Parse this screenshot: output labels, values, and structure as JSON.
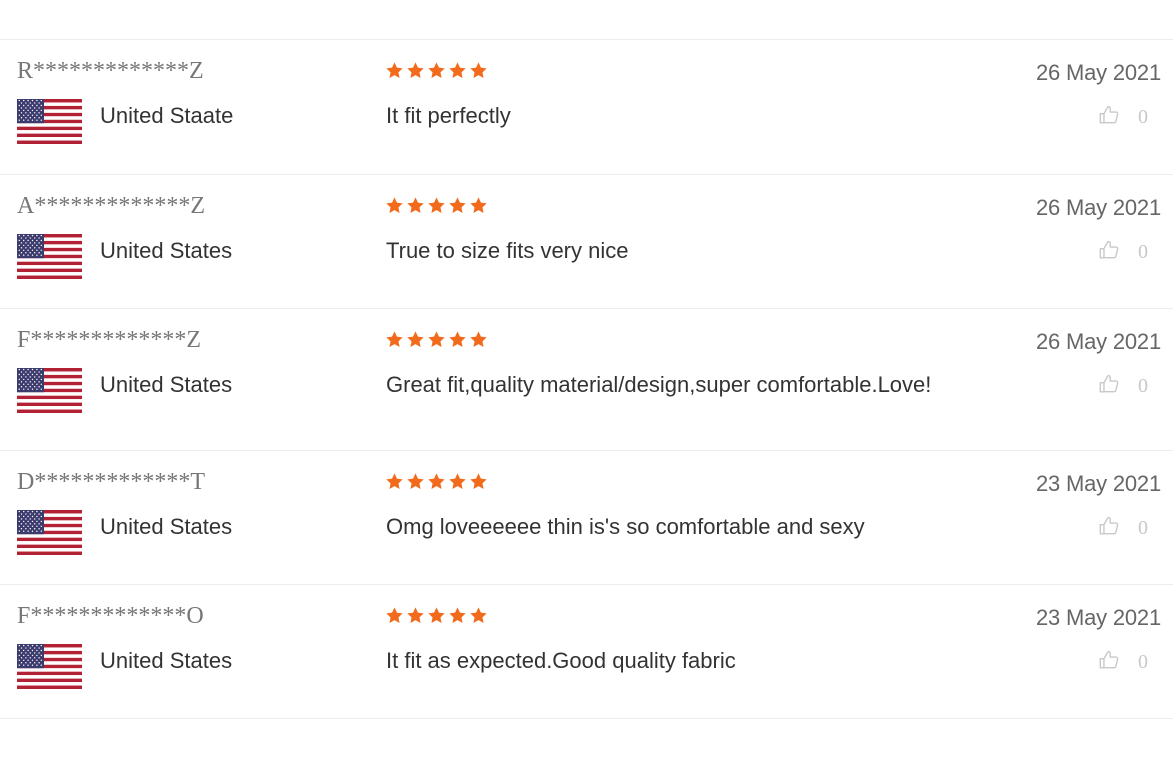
{
  "colors": {
    "star": "#f26b1d",
    "divider": "#ececec",
    "muted": "#c8c8c8"
  },
  "reviews": [
    {
      "name": "R*************Z",
      "country": "United Staate",
      "flag_icon": "us-flag-icon",
      "rating": 5,
      "content": "It fit perfectly",
      "date": "26 May 2021",
      "likes": "0"
    },
    {
      "name": "A*************Z",
      "country": "United States",
      "flag_icon": "us-flag-icon",
      "rating": 5,
      "content": "True to size fits very nice",
      "date": "26 May 2021",
      "likes": "0"
    },
    {
      "name": "F*************Z",
      "country": "United States",
      "flag_icon": "us-flag-icon",
      "rating": 5,
      "content": "Great fit,quality material/design,super comfortable.Love!",
      "date": "26 May 2021",
      "likes": "0"
    },
    {
      "name": "D*************T",
      "country": "United States",
      "flag_icon": "us-flag-icon",
      "rating": 5,
      "content": "Omg loveeeeee thin is's so comfortable and sexy",
      "date": "23 May 2021",
      "likes": "0"
    },
    {
      "name": "F*************O",
      "country": "United States",
      "flag_icon": "us-flag-icon",
      "rating": 5,
      "content": "It fit as expected.Good quality fabric",
      "date": "23 May 2021",
      "likes": "0"
    }
  ]
}
